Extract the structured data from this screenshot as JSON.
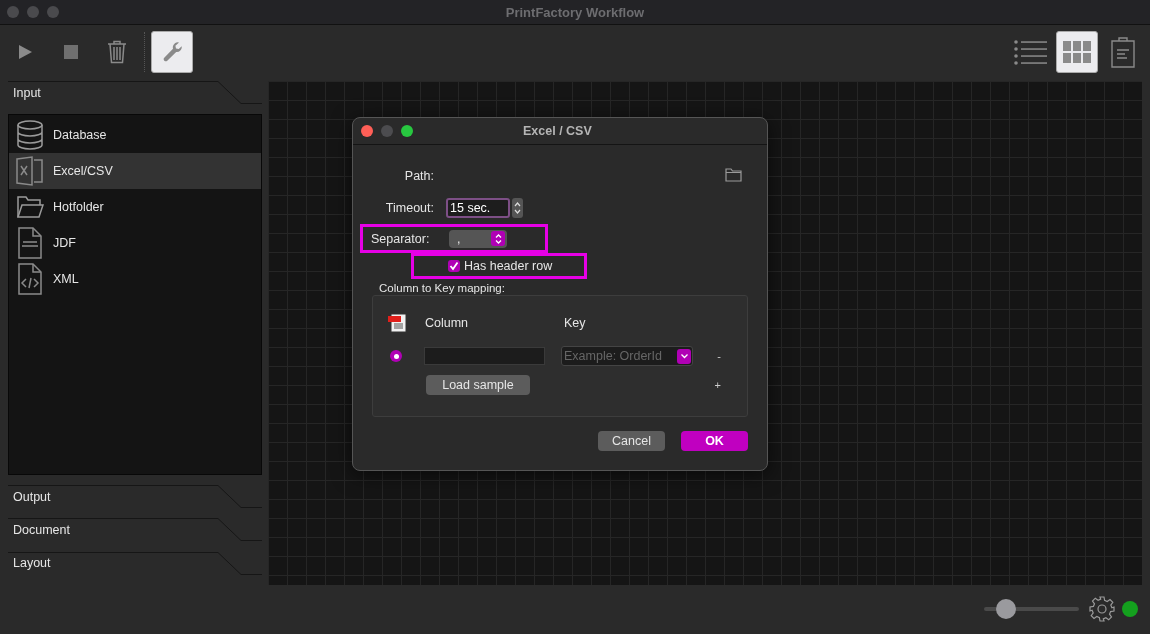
{
  "window": {
    "title": "PrintFactory Workflow"
  },
  "toolbar": {
    "left": [
      {
        "kind": "play",
        "selected": false
      },
      {
        "kind": "stop",
        "selected": false
      },
      {
        "kind": "trash",
        "selected": false
      },
      {
        "kind": "wrench",
        "selected": true
      }
    ],
    "right": [
      {
        "kind": "list",
        "selected": false
      },
      {
        "kind": "grid",
        "selected": true
      },
      {
        "kind": "clipboard",
        "selected": false
      }
    ]
  },
  "sidebar": {
    "sections": [
      {
        "label": "Input",
        "expanded": true,
        "items": [
          {
            "label": "Database",
            "kind": "database",
            "selected": false
          },
          {
            "label": "Excel/CSV",
            "kind": "excel",
            "selected": true
          },
          {
            "label": "Hotfolder",
            "kind": "folder",
            "selected": false
          },
          {
            "label": "JDF",
            "kind": "jdf",
            "selected": false
          },
          {
            "label": "XML",
            "kind": "xml",
            "selected": false
          }
        ]
      },
      {
        "label": "Output",
        "expanded": false
      },
      {
        "label": "Document",
        "expanded": false
      },
      {
        "label": "Layout",
        "expanded": false
      }
    ]
  },
  "dialog": {
    "title": "Excel / CSV",
    "path": {
      "label": "Path:"
    },
    "timeout": {
      "label": "Timeout:",
      "value": "15 sec.",
      "focused": true
    },
    "separator": {
      "label": "Separator:",
      "value": ",",
      "highlighted": true
    },
    "header_row": {
      "label": "Has header row",
      "checked": true,
      "highlighted": true
    },
    "mapping": {
      "label": "Column to Key mapping:",
      "column_header": "Column",
      "key_header": "Key",
      "rows": [
        {
          "selected": true,
          "key_placeholder": "Example: OrderId",
          "remove": "-"
        }
      ],
      "load_sample": "Load sample",
      "add": "+"
    },
    "buttons": [
      {
        "label": "Cancel",
        "kind": "normal"
      },
      {
        "label": "OK",
        "kind": "default"
      }
    ]
  },
  "status_bar": {
    "zoom": {
      "level": 0.18
    },
    "status": {
      "color": "#14a01e"
    }
  }
}
